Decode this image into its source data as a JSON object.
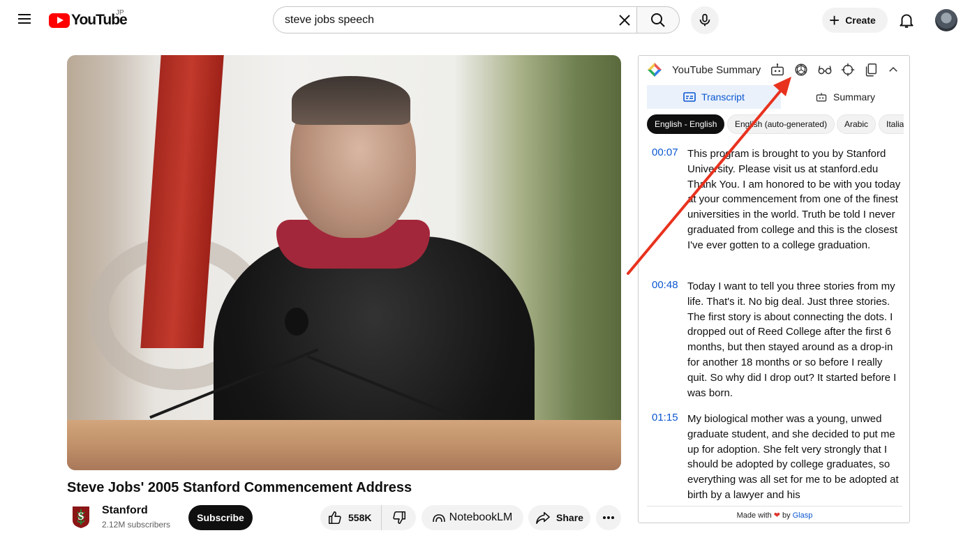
{
  "header": {
    "logo_text": "YouTube",
    "country_code": "JP",
    "search_value": "steve jobs speech",
    "create_label": "Create"
  },
  "video": {
    "title": "Steve Jobs' 2005 Stanford Commencement Address",
    "channel_name": "Stanford",
    "subscribers": "2.12M subscribers",
    "subscribe_label": "Subscribe",
    "like_count": "558K",
    "notebook_label": "NotebookLM",
    "share_label": "Share"
  },
  "panel": {
    "title": "YouTube Summary",
    "tabs": [
      {
        "label": "Transcript",
        "active": true
      },
      {
        "label": "Summary",
        "active": false
      }
    ],
    "languages": [
      {
        "label": "English - English",
        "active": true
      },
      {
        "label": "English (auto-generated)",
        "active": false
      },
      {
        "label": "Arabic",
        "active": false
      },
      {
        "label": "Italian",
        "active": false
      }
    ],
    "transcript": [
      {
        "time": "00:07",
        "text": "This program is brought to you by Stanford University. Please visit us at stanford.edu Thank You. I am honored to be with you today at your commencement from one of the finest universities in the world. Truth be told I never graduated from college and this is the closest I've ever gotten to a college graduation."
      },
      {
        "time": "00:48",
        "text": "Today I want to tell you three stories from my life. That's it. No big deal. Just three stories. The first story is about connecting the dots. I dropped out of Reed College after the first 6 months, but then stayed around as a drop-in for another 18 months or so before I really quit. So why did I drop out? It started before I was born."
      },
      {
        "time": "01:15",
        "text": "My biological mother was a young, unwed graduate student, and she decided to put me up for adoption. She felt very strongly that I should be adopted by college graduates, so everything was all set for me to be adopted at birth by a lawyer and his"
      }
    ],
    "footer_prefix": "Made with",
    "footer_by": "by",
    "footer_brand": "Glasp"
  },
  "colors": {
    "youtube_red": "#ff0000",
    "link_blue": "#0b57d0",
    "annotation_red": "#e8321e"
  }
}
